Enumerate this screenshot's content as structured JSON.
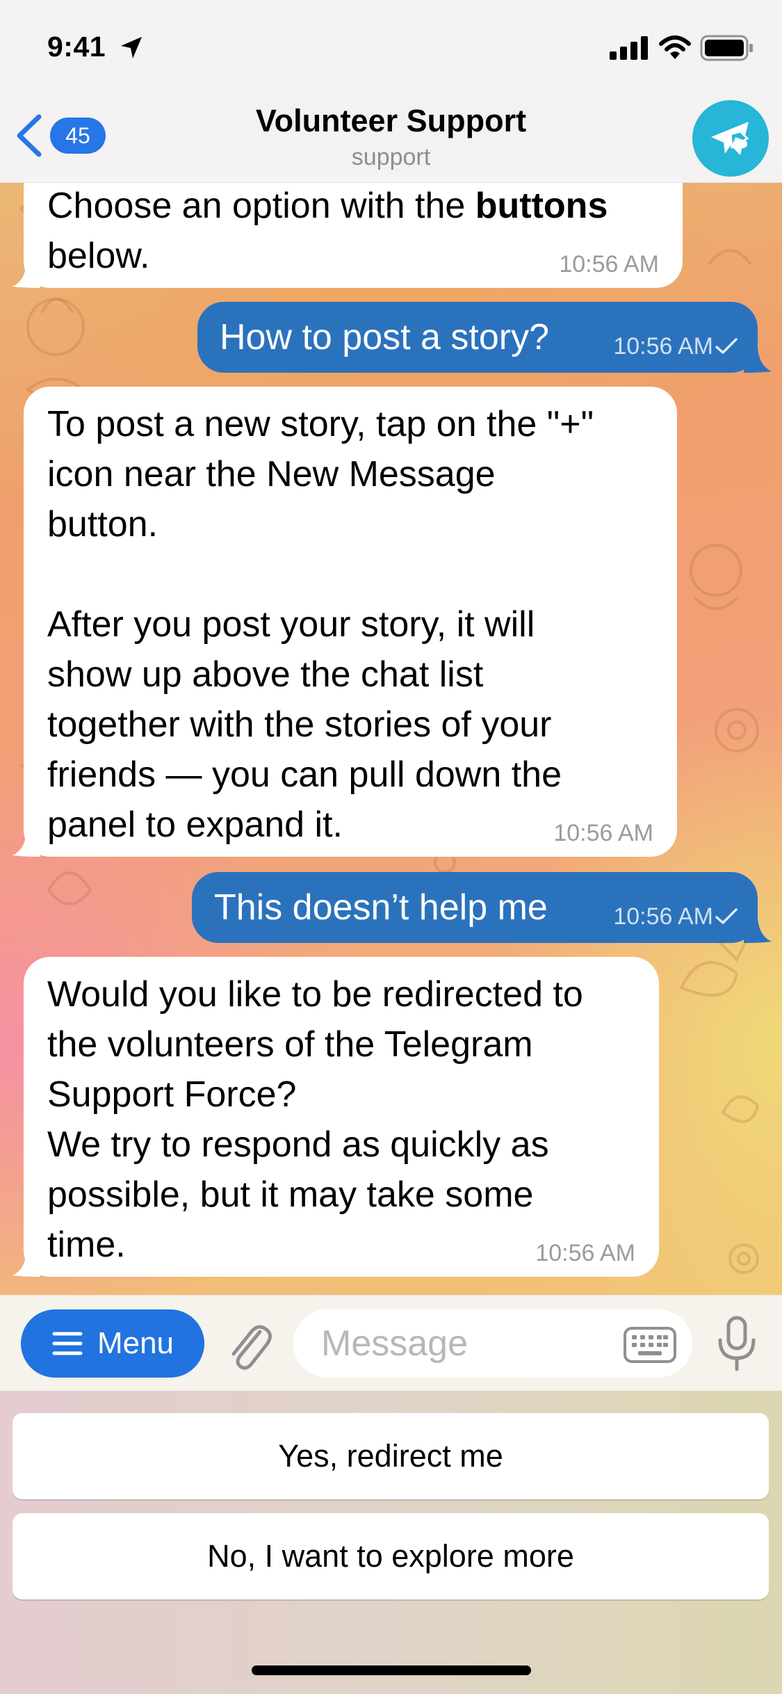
{
  "status_bar": {
    "time": "9:41"
  },
  "header": {
    "back_count": "45",
    "title": "Volunteer Support",
    "subtitle": "support"
  },
  "messages": [
    {
      "direction": "in",
      "text_plain": "Choose an option with the ",
      "text_bold": "buttons",
      "text_tail": "below.",
      "time": "10:56 AM"
    },
    {
      "direction": "out",
      "text": "How to post a story?",
      "time": "10:56 AM"
    },
    {
      "direction": "in",
      "text": "To post a new story, tap on the \"+\"\nicon near the New Message\nbutton.\n\nAfter you post your story, it will\nshow up above the chat list\ntogether with the stories of your\nfriends — you can pull down the\npanel to expand it.",
      "time": "10:56 AM"
    },
    {
      "direction": "out",
      "text": "This doesn’t help me",
      "time": "10:56 AM"
    },
    {
      "direction": "in",
      "text": "Would you like to be redirected to\nthe volunteers of the Telegram\nSupport Force?\nWe try to respond as quickly as\npossible, but it may take some\ntime.",
      "time": "10:56 AM"
    }
  ],
  "composer": {
    "menu_label": "Menu",
    "placeholder": "Message"
  },
  "reply_keyboard": [
    {
      "label": "Yes, redirect me"
    },
    {
      "label": "No, I want to explore more"
    }
  ],
  "colors": {
    "accent": "#2173df",
    "outgoing_bubble": "#2b72bd",
    "avatar": "#27b5d8"
  },
  "icons": [
    "location-arrow-icon",
    "signal-icon",
    "wifi-icon",
    "battery-icon",
    "back-chevron-icon",
    "bot-avatar-icon",
    "menu-lines-icon",
    "paperclip-icon",
    "keyboard-icon",
    "microphone-icon",
    "checkmark-icon"
  ]
}
